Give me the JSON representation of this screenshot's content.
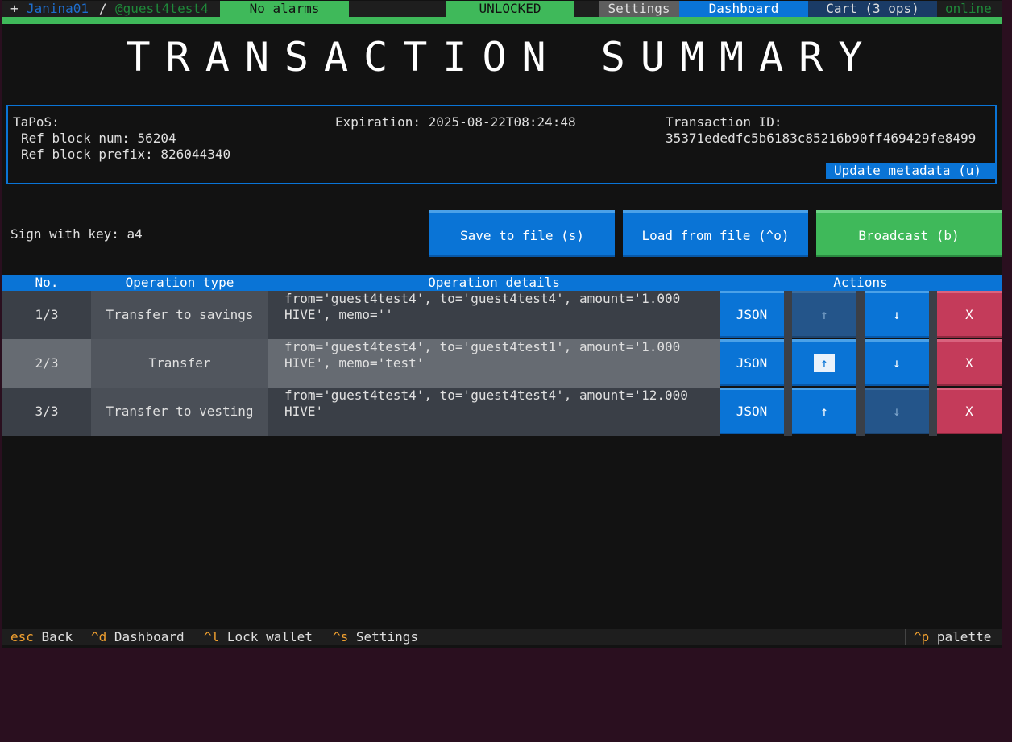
{
  "header": {
    "plus": "+",
    "account": "Janina01",
    "separator": "/",
    "profile": "@guest4test4",
    "alarms": "No alarms",
    "lock_status": "UNLOCKED",
    "settings": "Settings",
    "dashboard": "Dashboard",
    "cart": "Cart (3 ops)",
    "status": "online"
  },
  "title": "TRANSACTION SUMMARY",
  "metadata": {
    "tapos_label": "TaPoS:",
    "ref_block_num": "Ref block num: 56204",
    "ref_block_prefix": "Ref block prefix: 826044340",
    "expiration": "Expiration: 2025-08-22T08:24:48",
    "txid_label": "Transaction ID:",
    "txid": "35371ededfc5b6183c85216b90ff469429fe8499",
    "update_button": "Update metadata (u)"
  },
  "sign_with_key": "Sign with key: a4",
  "buttons": {
    "save": "Save to file (s)",
    "load": "Load from file (^o)",
    "broadcast": "Broadcast (b)"
  },
  "table": {
    "headers": [
      "No.",
      "Operation type",
      "Operation details",
      "Actions"
    ],
    "rows": [
      {
        "no": "1/3",
        "type": "Transfer to savings",
        "details": "from='guest4test4', to='guest4test4', amount='1.000 HIVE', memo=''",
        "json": "JSON",
        "up": "↑",
        "down": "↓",
        "remove": "X"
      },
      {
        "no": "2/3",
        "type": "Transfer",
        "details": "from='guest4test4', to='guest4test1', amount='1.000 HIVE', memo='test'",
        "json": "JSON",
        "up": "↑",
        "down": "↓",
        "remove": "X"
      },
      {
        "no": "3/3",
        "type": "Transfer to vesting",
        "details": "from='guest4test4', to='guest4test4', amount='12.000 HIVE'",
        "json": "JSON",
        "up": "↑",
        "down": "↓",
        "remove": "X"
      }
    ]
  },
  "footer": {
    "items": [
      {
        "key": "esc",
        "label": "Back"
      },
      {
        "key": "^d",
        "label": "Dashboard"
      },
      {
        "key": "^l",
        "label": "Lock wallet"
      },
      {
        "key": "^s",
        "label": "Settings"
      }
    ],
    "palette_key": "^p",
    "palette_label": "palette"
  },
  "colors": {
    "accent_blue": "#0a74d6",
    "accent_green": "#3fb95a",
    "danger_red": "#c43b5a",
    "background": "#121212"
  }
}
